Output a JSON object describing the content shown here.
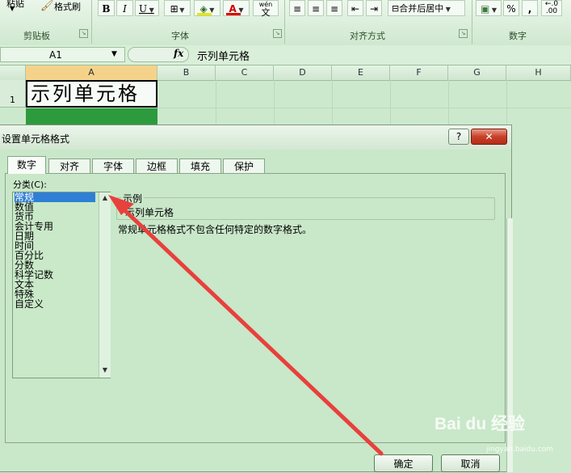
{
  "ribbon": {
    "paste_label": "粘贴",
    "format_painter_label": "格式刷",
    "bold": "B",
    "italic": "I",
    "underline": "U",
    "font_color_glyph": "A",
    "wen_glyph": "wén",
    "wen_char": "文",
    "merge_center_label": "合并后居中",
    "percent": "%",
    "comma": ",",
    "groups": [
      "剪贴板",
      "字体",
      "对齐方式",
      "数字"
    ]
  },
  "formula_bar": {
    "name_box": "A1",
    "fx": "fx",
    "content": "示列单元格"
  },
  "grid": {
    "columns": [
      "A",
      "B",
      "C",
      "D",
      "E",
      "F",
      "G",
      "H"
    ],
    "row1": "1",
    "cell_a1": "示列单元格"
  },
  "dialog": {
    "title": "设置单元格格式",
    "help": "?",
    "close": "✕",
    "tabs": [
      "数字",
      "对齐",
      "字体",
      "边框",
      "填充",
      "保护"
    ],
    "category_label": "分类(C):",
    "categories": [
      "常规",
      "数值",
      "货币",
      "会计专用",
      "日期",
      "时间",
      "百分比",
      "分数",
      "科学记数",
      "文本",
      "特殊",
      "自定义"
    ],
    "selected_category": "常规",
    "sample_label": "示例",
    "sample_value": "示列单元格",
    "description": "常规单元格格式不包含任何特定的数字格式。",
    "ok_label": "确定",
    "cancel_label": "取消"
  },
  "annotation": {
    "arrow_color": "#e8403c"
  },
  "watermark": {
    "brand": "Bai du 经验",
    "sub": "jingyan.baidu.com"
  }
}
